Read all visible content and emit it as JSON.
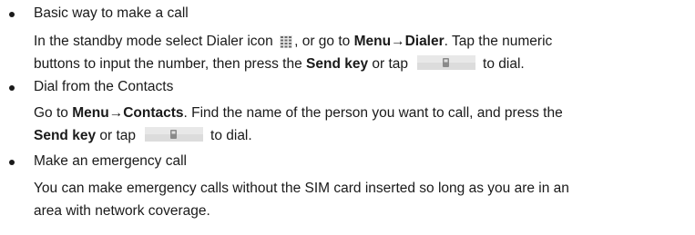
{
  "items": [
    {
      "heading": "Basic way to make a call",
      "line1": {
        "t1": "In the standby mode select Dialer icon",
        "icon": "dialer-grid-icon",
        "t2": ", or go to",
        "b1": "Menu",
        "arrow": "→",
        "b2": "Dialer",
        "t3": ". Tap the numeric"
      },
      "line2": {
        "t1": "buttons to input the number, then press the",
        "b1": "Send key",
        "t2": "or tap",
        "icon": "send-call-icon",
        "t3": "to dial."
      }
    },
    {
      "heading": "Dial from the Contacts",
      "line1": {
        "t1": "Go to",
        "b1": "Menu",
        "arrow": "→",
        "b2": "Contacts",
        "t2": ". Find the name of the person you want to call, and press the"
      },
      "line2": {
        "b1": "Send key",
        "t1": "or tap",
        "icon": "send-call-icon",
        "t2": "to dial."
      }
    },
    {
      "heading": "Make an emergency call",
      "line1": "You can make emergency calls without the SIM card inserted so long as you are in an",
      "line2": "area with network coverage."
    }
  ]
}
